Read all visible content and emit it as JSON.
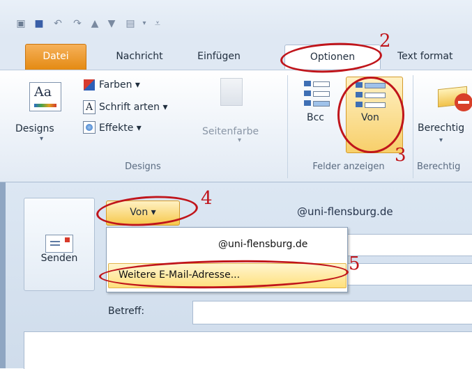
{
  "tabs": [
    "Datei",
    "Nachricht",
    "Einfügen",
    "Optionen",
    "Text format"
  ],
  "ribbon": {
    "designs_button": "Designs",
    "farben": "Farben ▾",
    "schriftarten": "Schrift arten ▾",
    "effekte": "Effekte ▾",
    "seitenfarbe": "Seitenfarbe",
    "bcc": "Bcc",
    "von": "Von",
    "berechtigung": "Berechtig",
    "group_designs": "Designs",
    "group_felder": "Felder anzeigen",
    "group_berechtigung": "Berechtig"
  },
  "compose": {
    "senden": "Senden",
    "von_button": "Von ▾",
    "from_address": "@uni-flensburg.de",
    "betreff_label": "Betreff:"
  },
  "dropdown": {
    "account": "@uni-flensburg.de",
    "more_addresses": "Weitere E-Mail-Adresse..."
  },
  "annotations": [
    "2",
    "3",
    "4",
    "5"
  ],
  "colors": {
    "highlight": "#f6c84c",
    "annotation_red": "#c0151b",
    "file_tab": "#e48a12"
  }
}
